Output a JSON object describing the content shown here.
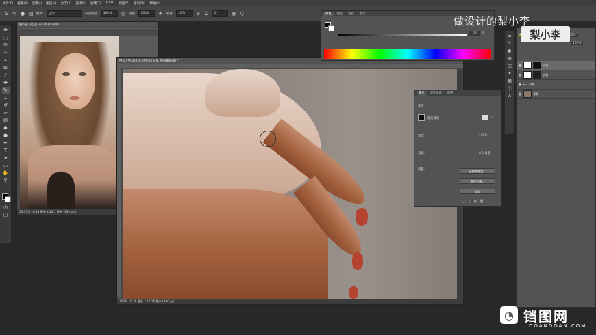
{
  "menubar": [
    "文件(F)",
    "编辑(E)",
    "图像(I)",
    "图层(L)",
    "文字(Y)",
    "选择(S)",
    "滤镜(T)",
    "3D(D)",
    "视图(V)",
    "窗口(W)",
    "帮助(H)"
  ],
  "options": {
    "mode_label": "模式:",
    "mode_value": "正常",
    "opacity_label": "不透明度:",
    "opacity_value": "100%",
    "flow_label": "流量:",
    "flow_value": "100%",
    "smooth_label": "平滑:",
    "smooth_value": "10%",
    "angle_value": "0°"
  },
  "doc1": {
    "tab": "换衣前.jpg @ 33.3%(RGB/8)",
    "status": "33.33%   16.36 厘米 x 10.7 厘米 (300 ppi)"
  },
  "doc2": {
    "tab": "换衣上色.psd @ 200% (头发, 图层蒙版/8) *",
    "status": "200%   16.36 厘米 x 12.16 厘米 (300 ppi)"
  },
  "color_panel": {
    "tabs": [
      "颜色",
      "色板",
      "渐变",
      "图案"
    ],
    "value": "100",
    "unit": "%"
  },
  "properties": {
    "tabs": [
      "属性",
      "历史记录",
      "调整"
    ],
    "section": "蒙版",
    "mask_label": "图层蒙版",
    "density_label": "浓度:",
    "density_value": "100%",
    "feather_label": "羽化:",
    "feather_value": "0.0 像素",
    "adjust_label": "调整:",
    "btn_select": "选择并遮住...",
    "btn_color_range": "颜色范围...",
    "btn_invert": "反相"
  },
  "layers": {
    "items": [
      {
        "name": "头发",
        "selected": true
      },
      {
        "name": "衣服",
        "selected": false
      },
      {
        "name": "背景",
        "selected": false
      },
      {
        "name": "背景",
        "selected": false
      }
    ],
    "opacity_value": "100%",
    "fill_value": "100%"
  },
  "watermark": {
    "top_text": "做设计的梨小李",
    "badge_text": "梨小李",
    "brand_cn": "铛图网",
    "brand_en": "DOANDOAN.COM"
  },
  "colors": {
    "menubar": "#3d3d3d",
    "workspace": "#282828",
    "panel": "#535353",
    "nail": "#b4432f"
  }
}
